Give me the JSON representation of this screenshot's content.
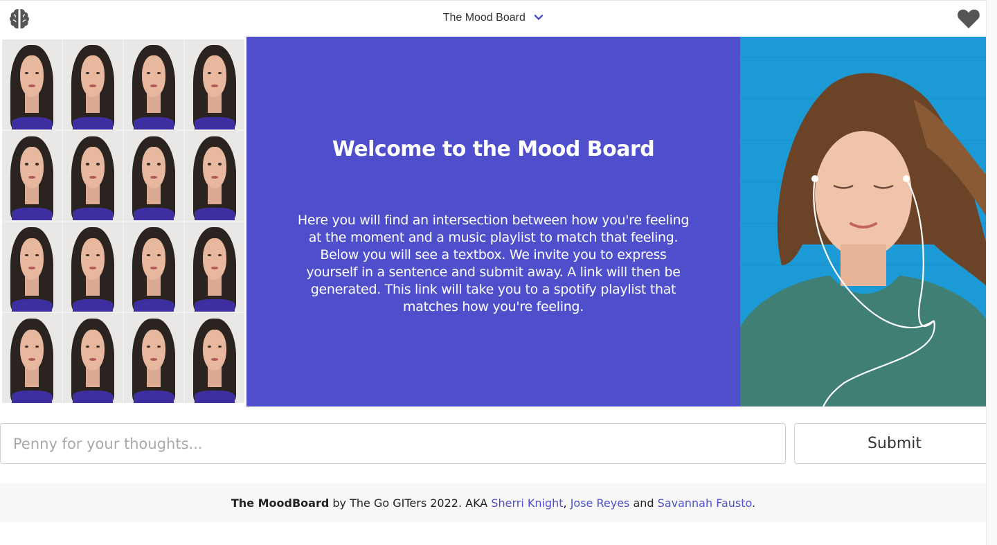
{
  "navbar": {
    "brand_icon": "brain-icon",
    "title": "The Mood Board",
    "dropdown_icon": "chevron-down-icon",
    "favorite_icon": "heart-icon"
  },
  "hero": {
    "heading": "Welcome to the Mood Board",
    "description": "Here you will find an intersection between how you're feeling at the moment and a music playlist to match that feeling. Below you will see a textbox. We invite you to express yourself in a sentence and submit away. A link will then be generated. This link will take you to a spotify playlist that matches how you're feeling.",
    "panel_color": "#4f4fcc"
  },
  "form": {
    "placeholder": "Penny for your thoughts...",
    "submit_label": "Submit"
  },
  "footer": {
    "brand": "The MoodBoard",
    "text_1": " by The Go GITers 2022. AKA ",
    "authors": [
      "Sherri Knight",
      "Jose Reyes",
      "Savannah Fausto"
    ],
    "sep_1": ", ",
    "sep_2": " and ",
    "end": ".",
    "link_color": "#4f4fcc"
  }
}
